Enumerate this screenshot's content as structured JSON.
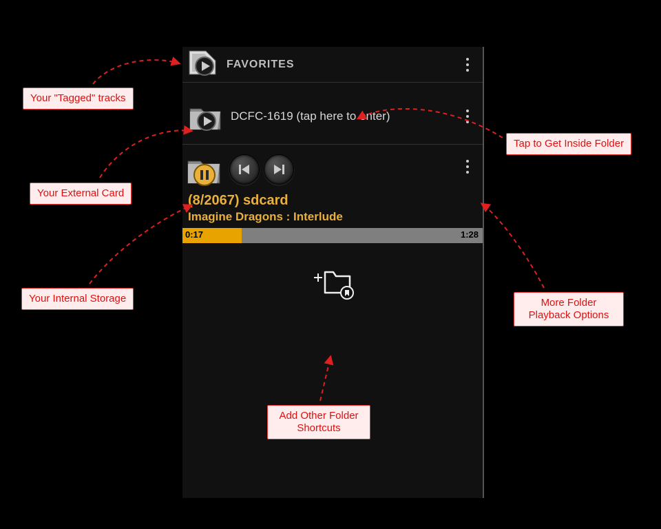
{
  "favorites": {
    "label": "FAVORITES"
  },
  "folder": {
    "label": "DCFC-1619 (tap here to enter)"
  },
  "now_playing": {
    "count_line": "(8/2067)  sdcard",
    "title": "Imagine Dragons : Interlude",
    "elapsed": "0:17",
    "total": "1:28"
  },
  "callouts": {
    "tagged": "Your \"Tagged\" tracks",
    "external": "Your External Card",
    "internal": "Your Internal Storage",
    "inside": "Tap to Get Inside Folder",
    "more_options": "More Folder Playback Options",
    "add_shortcut": "Add Other Folder Shortcuts"
  },
  "colors": {
    "accent": "#e9a300",
    "callout_border": "#e33",
    "callout_text": "#d11",
    "callout_bg": "#ffecec"
  }
}
